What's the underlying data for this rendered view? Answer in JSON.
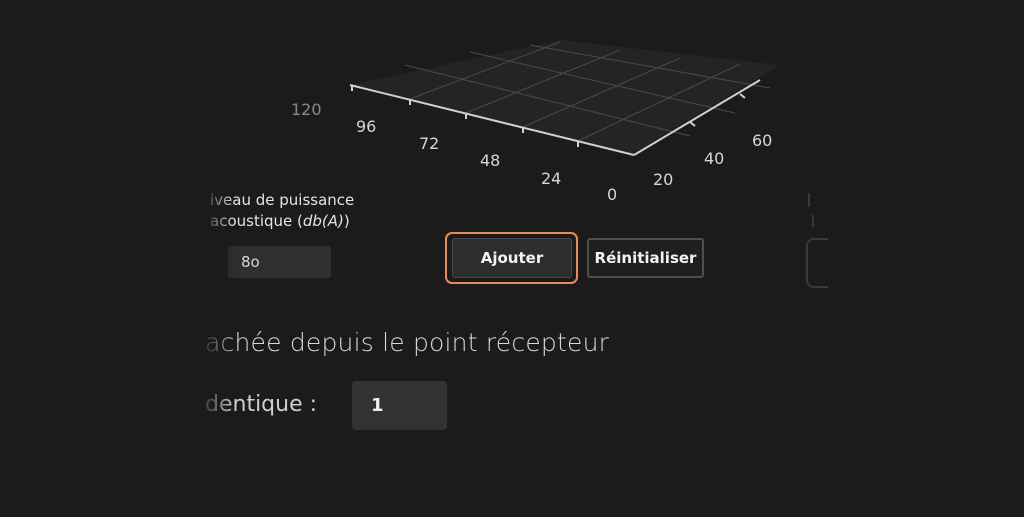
{
  "chart_axis": {
    "front_ticks": [
      "120",
      "96",
      "72",
      "48",
      "24",
      "0"
    ],
    "side_ticks": [
      "20",
      "40",
      "60"
    ]
  },
  "form": {
    "power_label_line1": "iveau de puissance",
    "power_label_line2_prefix": "acoustique (",
    "power_label_line2_unit": "db(A)",
    "power_label_line2_suffix": ")",
    "power_value": "8o",
    "add_button_label": "Ajouter",
    "reset_button_label": "Réinitialiser"
  },
  "section": {
    "heading": "achée depuis le point récepteur",
    "identique_label": "dentique :",
    "identique_value": "1"
  },
  "colors": {
    "focus_ring": "#e98a5a",
    "background": "#1b1b1b"
  }
}
